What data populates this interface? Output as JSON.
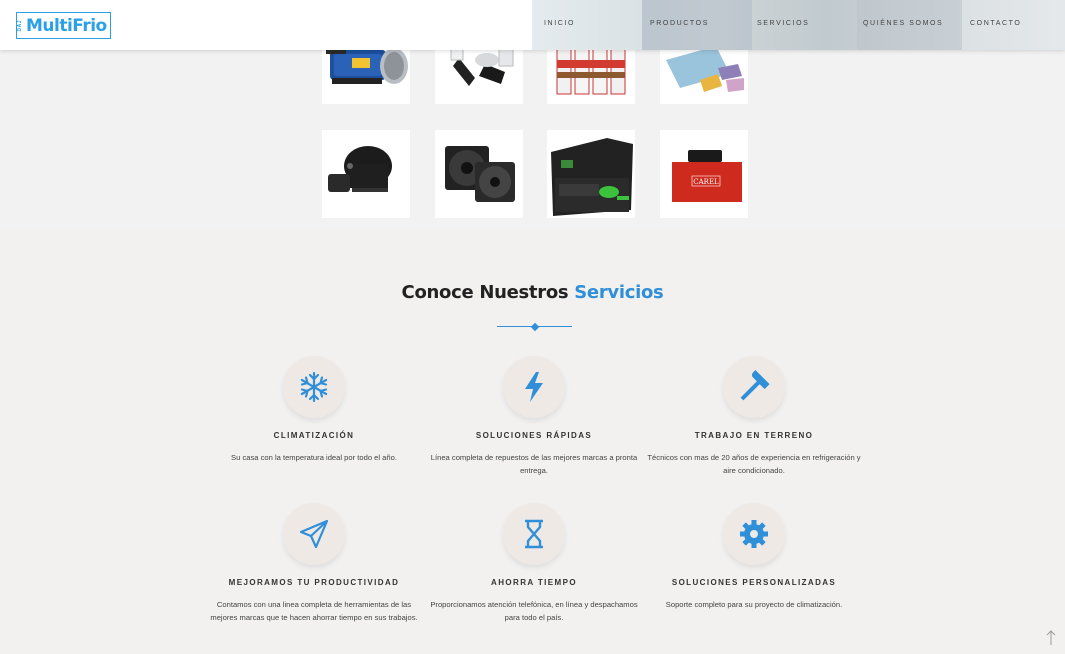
{
  "header": {
    "logo_side_text": "DAJ",
    "logo_text": "MultiFrio",
    "nav": [
      "INICIO",
      "PRODUCTOS",
      "SERVICIOS",
      "QUIÉNES SOMOS",
      "CONTACTO"
    ]
  },
  "products": {
    "row1": [
      "vacuum-pump",
      "pipe-insulation-tape",
      "refrigerant-cans",
      "copper-sheets"
    ],
    "row2": [
      "compressor",
      "axial-fans",
      "tool-case",
      "carel-controller"
    ],
    "carel_label": "CAREL"
  },
  "services_section": {
    "title_plain": "Conoce Nuestros",
    "title_accent": "Servicios",
    "accent_color": "#2f8fd8",
    "items": [
      {
        "icon": "snowflake-icon",
        "title": "CLIMATIZACIÓN",
        "desc": "Su casa con la temperatura ideal por todo el año."
      },
      {
        "icon": "lightning-bolt-icon",
        "title": "SOLUCIONES RÁPIDAS",
        "desc": "Línea completa de repuestos de las mejores marcas a pronta entrega."
      },
      {
        "icon": "hammer-icon",
        "title": "TRABAJO EN TERRENO",
        "desc": "Técnicos con mas de 20 años de experiencia en refrigeración y aire condicionado."
      },
      {
        "icon": "paper-plane-icon",
        "title": "MEJORAMOS TU PRODUCTIVIDAD",
        "desc": "Contamos con una linea completa de herramientas de las mejores marcas que te hacen ahorrar tiempo en sus trabajos."
      },
      {
        "icon": "hourglass-icon",
        "title": "AHORRA TIEMPO",
        "desc": "Proporcionamos atención telefónica, en línea y despachamos para todo el país."
      },
      {
        "icon": "gear-icon",
        "title": "SOLUCIONES PERSONALIZADAS",
        "desc": "Soporte completo para su proyecto de climatización."
      }
    ]
  },
  "scroll_top_icon": "arrow-up-icon"
}
